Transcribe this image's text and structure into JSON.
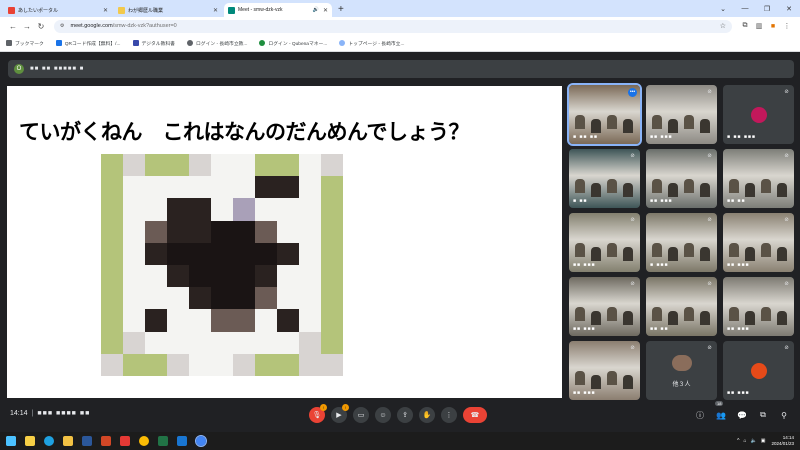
{
  "browser": {
    "tabs": [
      {
        "title": "あしたいポータル",
        "favicon_color": "#e94235",
        "active": false
      },
      {
        "title": "わが郷歴ル職業",
        "favicon_color": "#f2c94c",
        "active": false
      },
      {
        "title": "Meet - smw-dzk-vzk",
        "favicon_color": "#00897b",
        "active": true
      }
    ],
    "new_tab": "+",
    "url_domain": "meet.google.com",
    "url_path": "/smw-dzk-vzk?authuser=0",
    "bookmarks": [
      {
        "label": "ブックマーク",
        "color": "#5f6368"
      },
      {
        "label": "QRコード作成【無料】/...",
        "color": "#1a73e8"
      },
      {
        "label": "デジタル教科書",
        "color": "#3949ab"
      },
      {
        "label": "ログイン - 長崎市立教...",
        "color": "#5f6368"
      },
      {
        "label": "ログイン - Qubenaマネー...",
        "color": "#1e8e3e"
      },
      {
        "label": "トップページ - 長崎市立...",
        "color": "#8ab4f8"
      }
    ]
  },
  "meet": {
    "presenter_initial": "O",
    "presenter_name": "■■ ■■ ■■■■■ ■",
    "slide_title": "ていがくねん　これはなんのだんめんでしょう？",
    "participant_tiles": [
      {
        "label": "■ ■■ ■■",
        "kind": "video",
        "scene_color": "#7b6a57",
        "active": true
      },
      {
        "label": "■■ ■■■",
        "kind": "video",
        "scene_color": "#8d8a84"
      },
      {
        "label": "■ ■■ ■■■",
        "kind": "avatar",
        "avatar_color": "#c2185b",
        "avatar_text": "■■"
      },
      {
        "label": "■ ■■",
        "kind": "video",
        "scene_color": "#3e5557"
      },
      {
        "label": "■■ ■■■",
        "kind": "video",
        "scene_color": "#6a6e6a"
      },
      {
        "label": "■■ ■■",
        "kind": "video",
        "scene_color": "#7d7e78"
      },
      {
        "label": "■■ ■■■",
        "kind": "video",
        "scene_color": "#83806f"
      },
      {
        "label": "■ ■■■",
        "kind": "video",
        "scene_color": "#7d7868"
      },
      {
        "label": "■■ ■■■",
        "kind": "video",
        "scene_color": "#8a8172"
      },
      {
        "label": "■■ ■■■",
        "kind": "video",
        "scene_color": "#6e6a60"
      },
      {
        "label": "■■ ■■",
        "kind": "video",
        "scene_color": "#7a7566"
      },
      {
        "label": "■■ ■■■",
        "kind": "video",
        "scene_color": "#7d7a72"
      },
      {
        "label": "■■ ■■■",
        "kind": "video",
        "scene_color": "#8b7e70"
      },
      {
        "label": "他３人",
        "kind": "others",
        "avatar_color": "#8a6d5b"
      },
      {
        "label": "■■ ■■■",
        "kind": "avatar",
        "avatar_color": "#e64a19",
        "avatar_text": "■■"
      }
    ],
    "time": "14:14",
    "meeting_code": "■■■ ■■■■ ■■",
    "participant_count": "18",
    "mic_badge": "!",
    "cam_badge": "!",
    "colors": {
      "end_call": "#ea4335",
      "accent": "#8ab4f8",
      "warning": "#f29900"
    }
  },
  "taskbar": {
    "clock_time": "14:14",
    "clock_date": "2024/01/23",
    "apps": [
      {
        "name": "windows-start",
        "color": "#4cc2ff"
      },
      {
        "name": "sticky-notes",
        "color": "#f7d046"
      },
      {
        "name": "edge",
        "color": "#1fa1e0"
      },
      {
        "name": "file-explorer",
        "color": "#f3c244"
      },
      {
        "name": "word",
        "color": "#2b579a"
      },
      {
        "name": "powerpoint",
        "color": "#d24726"
      },
      {
        "name": "app-red",
        "color": "#e53935"
      },
      {
        "name": "chrome",
        "color": "#fbbc05"
      },
      {
        "name": "excel",
        "color": "#217346"
      },
      {
        "name": "app-blue",
        "color": "#1976d2"
      },
      {
        "name": "chrome-active",
        "color": "#4285f4"
      }
    ]
  }
}
